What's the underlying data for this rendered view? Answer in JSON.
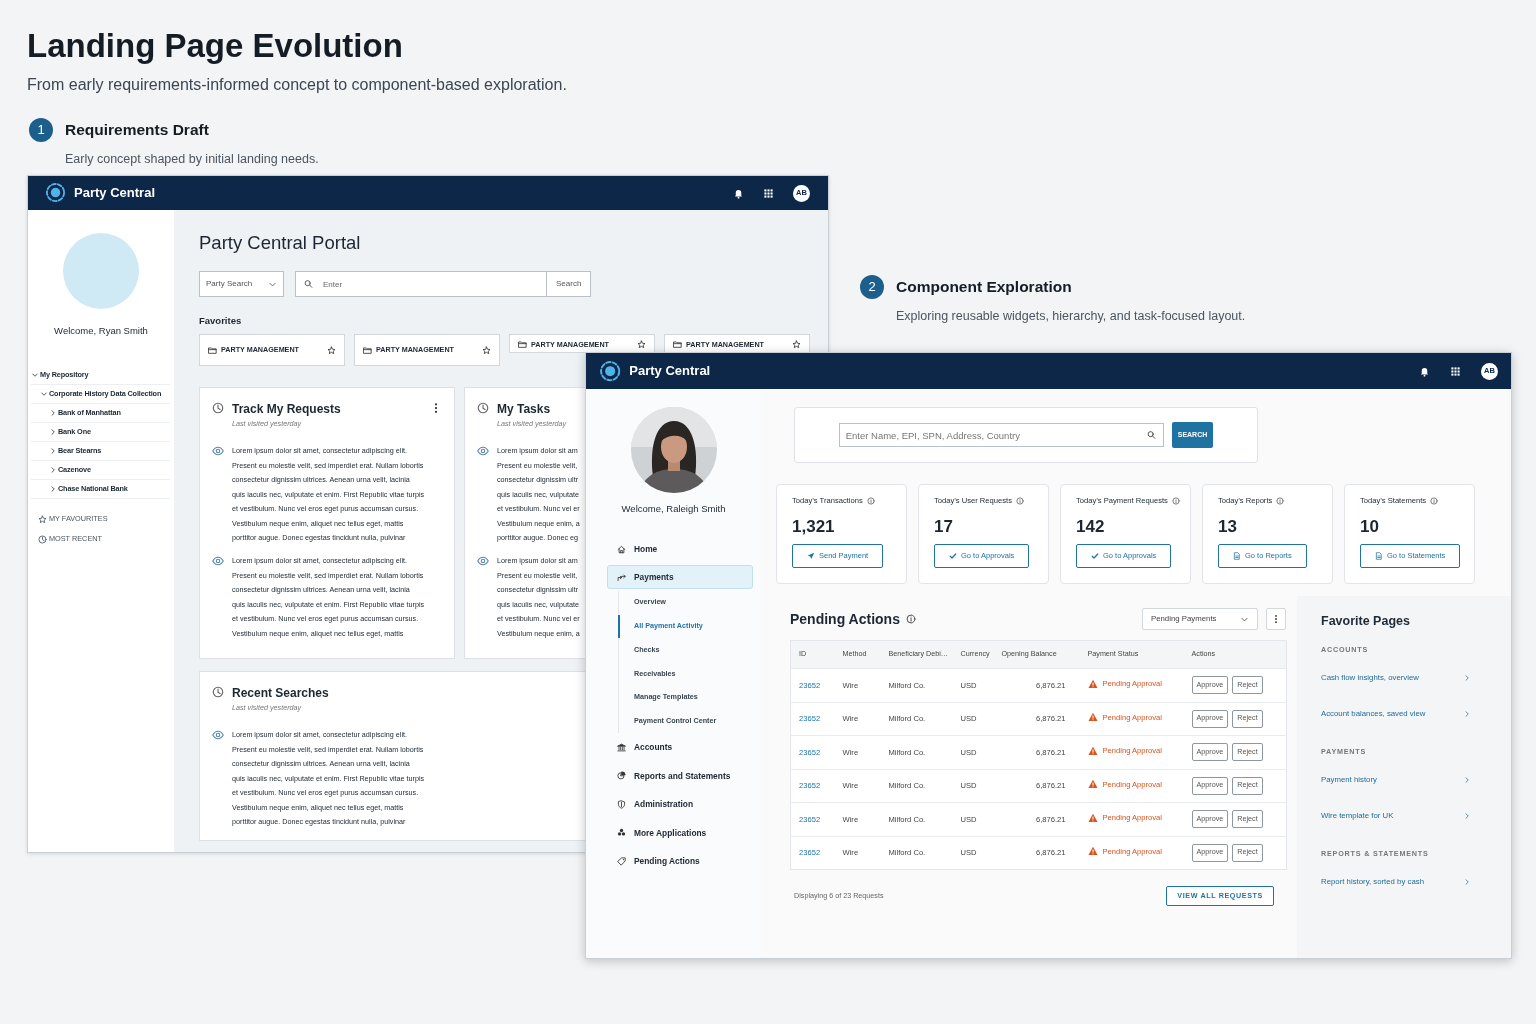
{
  "page": {
    "title": "Landing Page Evolution",
    "subtitle": "From early requirements-informed concept to component-based exploration."
  },
  "sections": [
    {
      "number": "1",
      "title": "Requirements Draft",
      "description": "Early concept shaped by initial landing needs."
    },
    {
      "number": "2",
      "title": "Component Exploration",
      "description": "Exploring reusable widgets, hierarchy, and task-focused layout."
    }
  ],
  "draft_window": {
    "app_name": "Party Central",
    "avatar_initials": "AB",
    "sidebar": {
      "welcome": "Welcome, Ryan Smith",
      "tree": [
        {
          "label": "My Repository",
          "expanded": true,
          "children": [
            {
              "label": "Corporate History Data Collection",
              "expanded": true,
              "children": [
                {
                  "label": "Bank of Manhattan",
                  "expanded": false
                },
                {
                  "label": "Bank One",
                  "expanded": false
                },
                {
                  "label": "Bear Stearns",
                  "expanded": false
                },
                {
                  "label": "Cazenove",
                  "expanded": false
                },
                {
                  "label": "Chase National Bank",
                  "expanded": false
                }
              ]
            }
          ]
        }
      ],
      "links": [
        {
          "kind": "star",
          "label": "MY FAVOURITES"
        },
        {
          "kind": "clock",
          "label": "MOST RECENT"
        }
      ]
    },
    "portal_title": "Party Central Portal",
    "search": {
      "scope": "Party Search",
      "placeholder": "Enter",
      "button": "Search"
    },
    "favorites_title": "Favorites",
    "favorites": [
      {
        "label": "PARTY MANAGEMENT"
      },
      {
        "label": "PARTY MANAGEMENT"
      },
      {
        "label": "PARTY MANAGEMENT"
      },
      {
        "label": "PARTY MANAGEMENT"
      }
    ],
    "cards": [
      {
        "title": "Track My Requests",
        "subtitle": "Last visited yesterday",
        "menu": true,
        "paragraphs": [
          [
            "Lorem ipsum dolor sit amet, consectetur adipiscing elit.",
            "Present eu molestie velit, sed imperdiet erat. Nullam lobortis",
            "consectetur dignissim ultrices. Aenean urna velit, lacinia",
            "quis iaculis nec, vulputate et enim. First Republic vitae turpis",
            "et vestibulum. Nunc vel eros eget purus accumsan cursus.",
            "Vestibulum neque enim, aliquet nec tellus eget, mattis",
            "porttitor augue. Donec egestas tincidunt nulla, pulvinar"
          ],
          [
            "Lorem ipsum dolor sit amet, consectetur adipiscing elit.",
            "Present eu molestie velit, sed imperdiet erat. Nullam lobortis",
            "consectetur dignissim ultrices. Aenean urna velit, lacinia",
            "quis iaculis nec, vulputate et enim. First Republic vitae turpis",
            "et vestibulum. Nunc vel eros eget purus accumsan cursus.",
            "Vestibulum neque enim, aliquet nec tellus eget, mattis"
          ]
        ]
      },
      {
        "title": "My Tasks",
        "subtitle": "Last visited yesterday",
        "menu": false,
        "paragraphs": [
          [
            "Lorem ipsum dolor sit am",
            "Present eu molestie velit,",
            "consectetur dignissim ultr",
            "quis iaculis nec, vulputate",
            "et vestibulum. Nunc vel er",
            "Vestibulum neque enim, a",
            "porttitor augue. Donec eg"
          ],
          [
            "Lorem ipsum dolor sit am",
            "Present eu molestie velit,",
            "consectetur dignissim ultr",
            "quis iaculis nec, vulputate",
            "et vestibulum. Nunc vel er",
            "Vestibulum neque enim, a"
          ]
        ]
      },
      {
        "title": "Recent Searches",
        "subtitle": "Last visited yesterday",
        "menu": false,
        "paragraphs": [
          [
            "Lorem ipsum dolor sit amet, consectetur adipiscing elit.",
            "Present eu molestie velit, sed imperdiet erat. Nullam lobortis",
            "consectetur dignissim ultrices. Aenean urna velit, lacinia",
            "quis iaculis nec, vulputate et enim. First Republic vitae turpis",
            "et vestibulum. Nunc vel eros eget purus accumsan cursus.",
            "Vestibulum neque enim, aliquet nec tellus eget, mattis",
            "porttitor augue. Donec egestas tincidunt nulla, pulvinar"
          ]
        ]
      }
    ]
  },
  "exploration_window": {
    "app_name": "Party Central",
    "avatar_initials": "AB",
    "sidebar": {
      "welcome": "Welcome, Raleigh Smith",
      "nav": [
        {
          "label": "Home",
          "selected": false
        },
        {
          "label": "Payments",
          "selected": true,
          "children": [
            {
              "label": "Overview",
              "selected": false
            },
            {
              "label": "All Payment Activity",
              "selected": true
            },
            {
              "label": "Checks",
              "selected": false
            },
            {
              "label": "Receivables",
              "selected": false
            },
            {
              "label": "Manage Templates",
              "selected": false
            },
            {
              "label": "Payment Control Center",
              "selected": false
            }
          ]
        },
        {
          "label": "Accounts",
          "selected": false
        },
        {
          "label": "Reports and Statements",
          "selected": false
        },
        {
          "label": "Administration",
          "selected": false
        },
        {
          "label": "More Applications",
          "selected": false
        },
        {
          "label": "Pending Actions",
          "selected": false
        }
      ]
    },
    "search": {
      "placeholder": "Enter Name, EPI, SPN, Address, Country",
      "button": "SEARCH"
    },
    "stats": [
      {
        "label": "Today’s Transactions",
        "value": "1,321",
        "action": "Send Payment"
      },
      {
        "label": "Today’s User Requests",
        "value": "17",
        "action": "Go to Approvals"
      },
      {
        "label": "Today’s Payment Requests",
        "value": "142",
        "action": "Go to Approvals"
      },
      {
        "label": "Today’s Reports",
        "value": "13",
        "action": "Go to Reports"
      },
      {
        "label": "Today’s Statements",
        "value": "10",
        "action": "Go to Statements"
      }
    ],
    "pending": {
      "title": "Pending Actions",
      "filter": "Pending Payments",
      "columns": [
        "ID",
        "Method",
        "Beneficiary Debi…",
        "Currency",
        "Opening Balance",
        "Payment Status",
        "Actions"
      ],
      "rows": [
        {
          "id": "23652",
          "method": "Wire",
          "beneficiary": "Milford Co.",
          "currency": "USD",
          "balance": "6,876.21",
          "status": "Pending Approval",
          "actions": [
            "Approve",
            "Reject"
          ]
        },
        {
          "id": "23652",
          "method": "Wire",
          "beneficiary": "Milford Co.",
          "currency": "USD",
          "balance": "6,876.21",
          "status": "Pending Approval",
          "actions": [
            "Approve",
            "Reject"
          ]
        },
        {
          "id": "23652",
          "method": "Wire",
          "beneficiary": "Milford Co.",
          "currency": "USD",
          "balance": "6,876.21",
          "status": "Pending Approval",
          "actions": [
            "Approve",
            "Reject"
          ]
        },
        {
          "id": "23652",
          "method": "Wire",
          "beneficiary": "Milford Co.",
          "currency": "USD",
          "balance": "6,876.21",
          "status": "Pending Approval",
          "actions": [
            "Approve",
            "Reject"
          ]
        },
        {
          "id": "23652",
          "method": "Wire",
          "beneficiary": "Milford Co.",
          "currency": "USD",
          "balance": "6,876.21",
          "status": "Pending Approval",
          "actions": [
            "Approve",
            "Reject"
          ]
        },
        {
          "id": "23652",
          "method": "Wire",
          "beneficiary": "Milford Co.",
          "currency": "USD",
          "balance": "6,876.21",
          "status": "Pending Approval",
          "actions": [
            "Approve",
            "Reject"
          ]
        }
      ],
      "footer": "Displaying 6 of 23 Requests",
      "view_all": "VIEW ALL REQUESTS"
    },
    "favorites": {
      "title": "Favorite Pages",
      "groups": [
        {
          "heading": "ACCOUNTS",
          "links": [
            "Cash flow insights, overview",
            "Account balances, saved view"
          ]
        },
        {
          "heading": "PAYMENTS",
          "links": [
            "Payment history",
            "Wire template for UK"
          ]
        },
        {
          "heading": "REPORTS & STATEMENTS",
          "links": [
            "Report history, sorted by cash"
          ]
        }
      ]
    }
  }
}
